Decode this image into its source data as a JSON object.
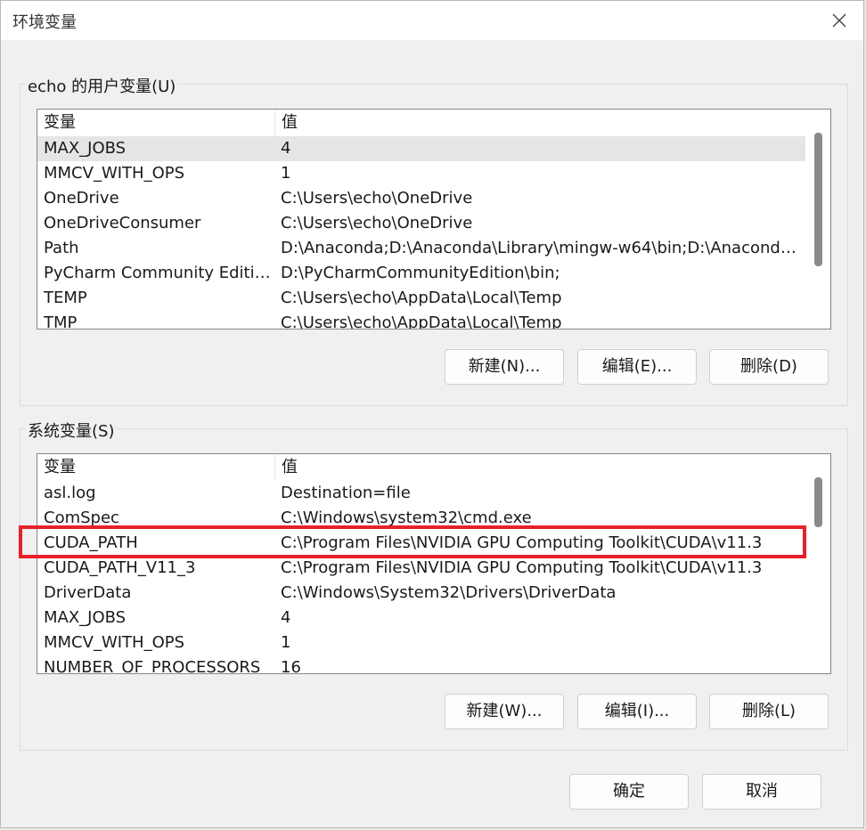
{
  "window": {
    "title": "环境变量"
  },
  "user_group": {
    "label": "echo 的用户变量(U)",
    "columns": [
      "变量",
      "值"
    ],
    "rows": [
      {
        "name": "MAX_JOBS",
        "value": "4"
      },
      {
        "name": "MMCV_WITH_OPS",
        "value": "1"
      },
      {
        "name": "OneDrive",
        "value": "C:\\Users\\echo\\OneDrive"
      },
      {
        "name": "OneDriveConsumer",
        "value": "C:\\Users\\echo\\OneDrive"
      },
      {
        "name": "Path",
        "value": "D:\\Anaconda;D:\\Anaconda\\Library\\mingw-w64\\bin;D:\\Anaconda\\..."
      },
      {
        "name": "PyCharm Community Edition",
        "value": "D:\\PyCharmCommunityEdition\\bin;"
      },
      {
        "name": "TEMP",
        "value": "C:\\Users\\echo\\AppData\\Local\\Temp"
      },
      {
        "name": "TMP",
        "value": "C:\\Users\\echo\\AppData\\Local\\Temp"
      }
    ],
    "buttons": {
      "new": "新建(N)...",
      "edit": "编辑(E)...",
      "delete": "删除(D)"
    }
  },
  "system_group": {
    "label": "系统变量(S)",
    "columns": [
      "变量",
      "值"
    ],
    "rows": [
      {
        "name": "asl.log",
        "value": "Destination=file"
      },
      {
        "name": "ComSpec",
        "value": "C:\\Windows\\system32\\cmd.exe"
      },
      {
        "name": "CUDA_PATH",
        "value": "C:\\Program Files\\NVIDIA GPU Computing Toolkit\\CUDA\\v11.3"
      },
      {
        "name": "CUDA_PATH_V11_3",
        "value": "C:\\Program Files\\NVIDIA GPU Computing Toolkit\\CUDA\\v11.3"
      },
      {
        "name": "DriverData",
        "value": "C:\\Windows\\System32\\Drivers\\DriverData"
      },
      {
        "name": "MAX_JOBS",
        "value": "4"
      },
      {
        "name": "MMCV_WITH_OPS",
        "value": "1"
      },
      {
        "name": "NUMBER_OF_PROCESSORS",
        "value": "16"
      }
    ],
    "buttons": {
      "new": "新建(W)...",
      "edit": "编辑(I)...",
      "delete": "删除(L)"
    }
  },
  "footer": {
    "ok": "确定",
    "cancel": "取消"
  },
  "colors": {
    "highlight": "#e8202c",
    "selected_row": "#e5e5e5"
  }
}
